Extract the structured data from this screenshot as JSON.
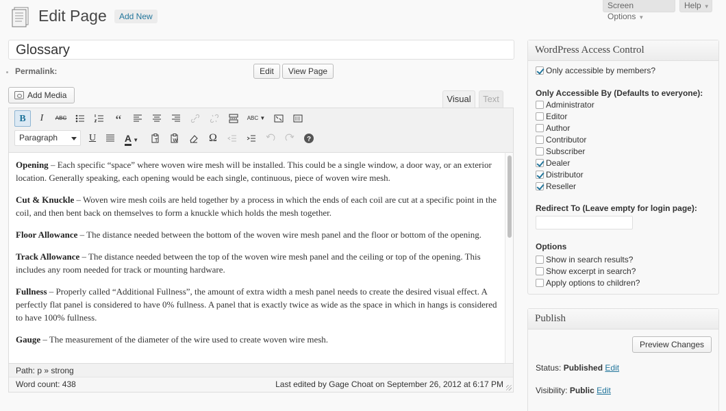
{
  "header": {
    "title": "Edit Page",
    "add_new": "Add New",
    "screen_options": "Screen Options",
    "help": "Help"
  },
  "post": {
    "title": "Glossary",
    "permalink_label": "Permalink:",
    "edit_button": "Edit",
    "view_page_button": "View Page"
  },
  "editor": {
    "add_media": "Add Media",
    "tab_visual": "Visual",
    "tab_text": "Text",
    "format_select": "Paragraph",
    "path": "Path: p » strong",
    "word_count": "Word count: 438",
    "last_edited": "Last edited by Gage Choat on September 26, 2012 at 6:17 PM",
    "entries": [
      {
        "term": "Opening",
        "text": " – Each specific “space” where woven wire mesh will be installed. This could be a single window, a door way, or an exterior location. Generally speaking, each opening would be each single, continuous, piece of woven wire mesh."
      },
      {
        "term": "Cut & Knuckle",
        "text": " – Woven wire mesh coils are held together by a process in which the ends of each coil are cut at a specific point in the coil, and then bent back on themselves to form a knuckle which holds the mesh together."
      },
      {
        "term": "Floor Allowance",
        "text": " – The distance needed between the bottom of the woven wire mesh panel and the floor or bottom of the opening."
      },
      {
        "term": "Track Allowance",
        "text": " – The distance needed between the top of the woven wire mesh panel and the ceiling or top of the opening. This includes any room needed for track or mounting hardware."
      },
      {
        "term": "Fullness",
        "text": " – Properly called “Additional Fullness”, the amount of extra width a mesh panel needs to create the desired visual effect. A perfectly flat panel is considered to have 0% fullness. A panel that is exactly twice as wide as the space in which in hangs is considered to have 100% fullness."
      },
      {
        "term": "Gauge",
        "text": " – The measurement of the diameter of the wire used to create woven wire mesh."
      }
    ]
  },
  "access_control": {
    "title": "WordPress Access Control",
    "only_members": "Only accessible by members?",
    "only_members_checked": true,
    "accessible_by_label": "Only Accessible By (Defaults to everyone):",
    "roles": [
      {
        "label": "Administrator",
        "checked": false
      },
      {
        "label": "Editor",
        "checked": false
      },
      {
        "label": "Author",
        "checked": false
      },
      {
        "label": "Contributor",
        "checked": false
      },
      {
        "label": "Subscriber",
        "checked": false
      },
      {
        "label": "Dealer",
        "checked": true
      },
      {
        "label": "Distributor",
        "checked": true
      },
      {
        "label": "Reseller",
        "checked": true
      }
    ],
    "redirect_label": "Redirect To (Leave empty for login page):",
    "redirect_value": "",
    "options_label": "Options",
    "options": [
      {
        "label": "Show in search results?",
        "checked": false
      },
      {
        "label": "Show excerpt in search?",
        "checked": false
      },
      {
        "label": "Apply options to children?",
        "checked": false
      }
    ]
  },
  "publish": {
    "title": "Publish",
    "preview_button": "Preview Changes",
    "status_label": "Status:",
    "status_value": "Published",
    "visibility_label": "Visibility:",
    "visibility_value": "Public",
    "edit_link": "Edit"
  },
  "colors": {
    "link": "#21759b",
    "background": "#f9f9f9"
  }
}
